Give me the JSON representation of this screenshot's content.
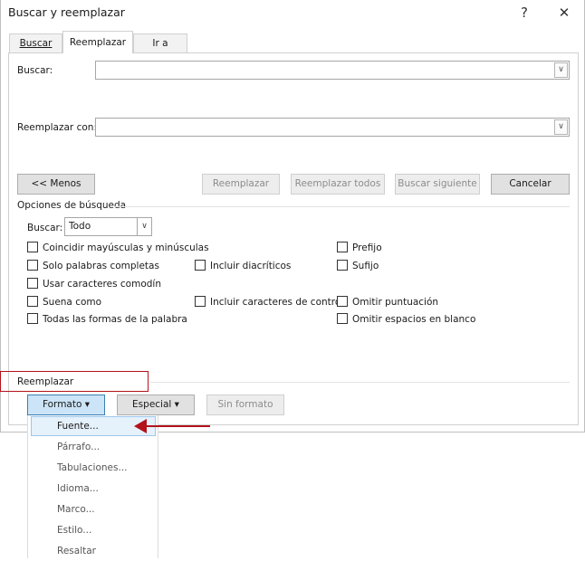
{
  "dialog": {
    "title": "Buscar y reemplazar",
    "help_label": "?",
    "close_label": "✕"
  },
  "tabs": [
    {
      "label": "Buscar"
    },
    {
      "label": "Reemplazar"
    },
    {
      "label": "Ir a"
    }
  ],
  "find": {
    "label": "Buscar:",
    "value": ""
  },
  "replace": {
    "label": "Reemplazar con:",
    "value": ""
  },
  "buttons": {
    "less": "<< Menos",
    "replace": "Reemplazar",
    "replace_all": "Reemplazar todos",
    "find_next": "Buscar siguiente",
    "cancel": "Cancelar"
  },
  "options": {
    "section_title": "Opciones de búsqueda",
    "search_label": "Buscar:",
    "search_value": "Todo",
    "checkboxes": {
      "match_case": "Coincidir mayúsculas y minúsculas",
      "whole_words": "Solo palabras completas",
      "wildcards": "Usar caracteres comodín",
      "sounds_like": "Suena como",
      "all_forms": "Todas las formas de la palabra",
      "diacritics": "Incluir diacríticos",
      "control_chars": "Incluir caracteres de control",
      "prefix": "Prefijo",
      "suffix": "Sufijo",
      "ignore_punct": "Omitir puntuación",
      "ignore_space": "Omitir espacios en blanco"
    }
  },
  "replace_section": {
    "title": "Reemplazar",
    "format_button": "Formato ▾",
    "special_button": "Especial ▾",
    "no_format_button": "Sin formato"
  },
  "format_menu": [
    {
      "label": "Fuente..."
    },
    {
      "label": "Párrafo..."
    },
    {
      "label": "Tabulaciones..."
    },
    {
      "label": "Idioma..."
    },
    {
      "label": "Marco..."
    },
    {
      "label": "Estilo..."
    },
    {
      "label": "Resaltar"
    }
  ],
  "colors": {
    "annotation_red": "#b3121b",
    "menu_highlight": "#e5f1fb",
    "pressed_button": "#cce4f7"
  }
}
